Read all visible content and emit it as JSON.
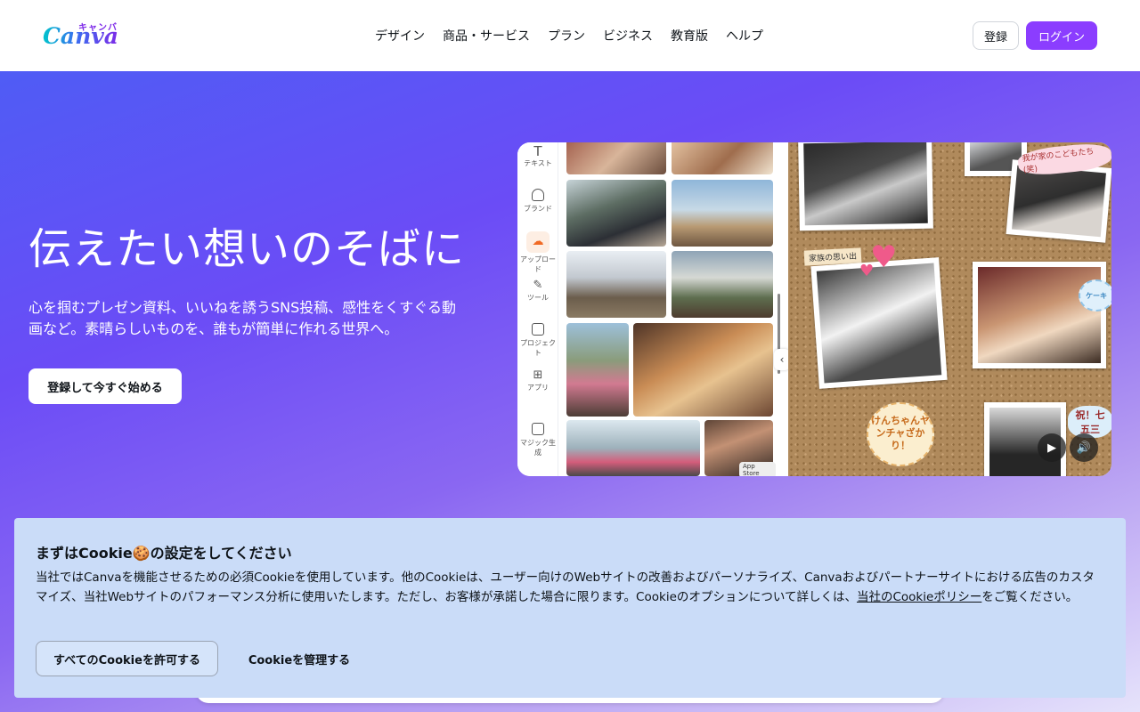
{
  "header": {
    "logo_kana": "キャンバ",
    "logo_word": "Canva",
    "nav": [
      "デザイン",
      "商品・サービス",
      "プラン",
      "ビジネス",
      "教育版",
      "ヘルプ"
    ],
    "register_label": "登録",
    "login_label": "ログイン"
  },
  "hero": {
    "title": "伝えたい想いのそばに",
    "subtitle": "心を掴むプレゼン資料、いいねを誘うSNS投稿、感性をくすぐる動画など。素晴らしいものを、誰もが簡単に作れる世界へ。",
    "cta_label": "登録して今すぐ始める"
  },
  "editor": {
    "sidebar": [
      {
        "label": "テキスト",
        "icon": "text-icon"
      },
      {
        "label": "ブランド",
        "icon": "brand-icon"
      },
      {
        "label": "アップロード",
        "icon": "upload-icon"
      },
      {
        "label": "ツール",
        "icon": "pen-icon"
      },
      {
        "label": "プロジェクト",
        "icon": "folder-icon"
      },
      {
        "label": "アプリ",
        "icon": "apps-icon"
      },
      {
        "label": "マジック生成",
        "icon": "magic-icon"
      }
    ],
    "board_label": "家族の思い出",
    "note_top": "我が家のこどもたち(笑)",
    "note_right": "ケーキ",
    "bubble_text": "けんちゃんヤンチャざかり！",
    "tag_right": "祝！七五三",
    "app_store": "App Store"
  },
  "cookie": {
    "title": "まずはCookie🍪の設定をしてください",
    "text": "当社ではCanvaを機能させるための必須Cookieを使用しています。他のCookieは、ユーザー向けのWebサイトの改善およびパーソナライズ、Canvaおよびパートナーサイトにおける広告のカスタマイズ、当社Webサイトのパフォーマンス分析に使用いたします。ただし、お客様が承諾した場合に限ります。Cookieのオプションについて詳しくは、",
    "link": "当社のCookieポリシー",
    "text_end": "をご覧ください。",
    "allow_label": "すべてのCookieを許可する",
    "manage_label": "Cookieを管理する"
  }
}
